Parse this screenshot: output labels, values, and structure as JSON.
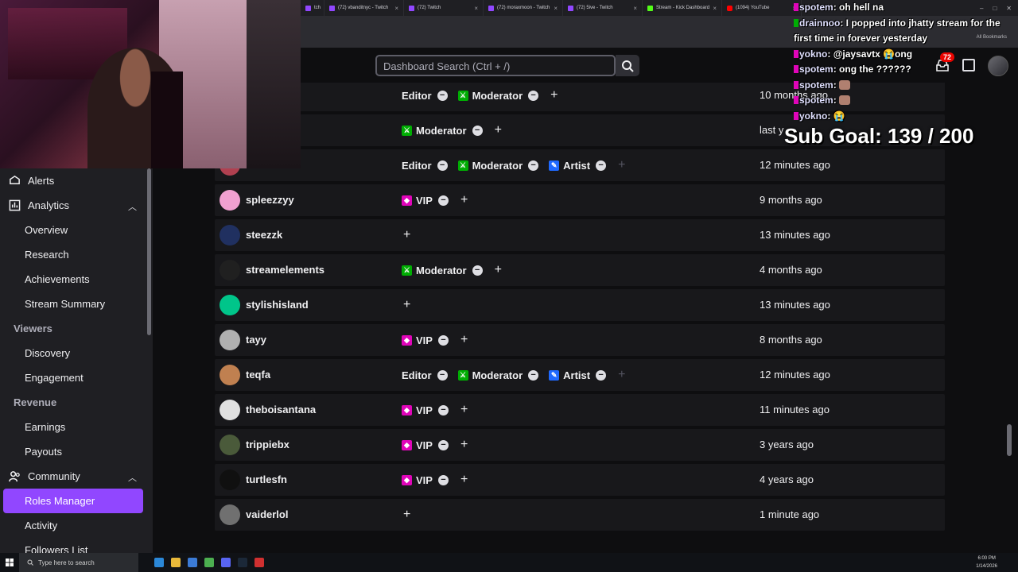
{
  "browser": {
    "tabs": [
      {
        "label": "tch",
        "icon": "twitch-icon"
      },
      {
        "label": "(72) vbanditnyc - Twitch",
        "icon": "twitch-icon"
      },
      {
        "label": "(72) Twitch",
        "icon": "twitch-icon"
      },
      {
        "label": "(72) moraxmoon - Twitch",
        "icon": "twitch-icon"
      },
      {
        "label": "(72) 5ive - Twitch",
        "icon": "twitch-icon"
      },
      {
        "label": "Stream - Kick Dashboard",
        "icon": "kick-icon"
      },
      {
        "label": "(1094) YouTube",
        "icon": "youtube-icon"
      }
    ],
    "all_bookmarks": "All Bookmarks"
  },
  "topbar": {
    "search_placeholder": "Dashboard Search (Ctrl + /)",
    "notification_count": "72"
  },
  "sidebar": {
    "items": [
      {
        "label": "Alerts",
        "type": "top",
        "icon": "alert-icon"
      },
      {
        "label": "Analytics",
        "type": "top",
        "icon": "analytics-icon",
        "expanded": true
      },
      {
        "label": "Overview",
        "type": "sub"
      },
      {
        "label": "Research",
        "type": "sub"
      },
      {
        "label": "Achievements",
        "type": "sub"
      },
      {
        "label": "Stream Summary",
        "type": "sub"
      },
      {
        "label": "Viewers",
        "type": "heading"
      },
      {
        "label": "Discovery",
        "type": "sub"
      },
      {
        "label": "Engagement",
        "type": "sub"
      },
      {
        "label": "Revenue",
        "type": "heading"
      },
      {
        "label": "Earnings",
        "type": "sub"
      },
      {
        "label": "Payouts",
        "type": "sub"
      },
      {
        "label": "Community",
        "type": "top",
        "icon": "community-icon",
        "expanded": true
      },
      {
        "label": "Roles Manager",
        "type": "sub",
        "active": true
      },
      {
        "label": "Activity",
        "type": "sub"
      },
      {
        "label": "Followers List",
        "type": "sub"
      }
    ]
  },
  "roles_table": {
    "rows": [
      {
        "username": "",
        "roles": [
          "Editor",
          "Moderator"
        ],
        "plus_dim": false,
        "when": "10 months ago"
      },
      {
        "username": "",
        "roles": [
          "Moderator"
        ],
        "plus_dim": false,
        "when": "last y"
      },
      {
        "username": "somelite",
        "roles": [
          "Editor",
          "Moderator",
          "Artist"
        ],
        "plus_dim": true,
        "when": "12 minutes ago"
      },
      {
        "username": "spleezzyy",
        "roles": [
          "VIP"
        ],
        "plus_dim": false,
        "when": "9 months ago"
      },
      {
        "username": "steezzk",
        "roles": [],
        "plus_dim": false,
        "when": "13 minutes ago"
      },
      {
        "username": "streamelements",
        "roles": [
          "Moderator"
        ],
        "plus_dim": false,
        "when": "4 months ago"
      },
      {
        "username": "stylishisland",
        "roles": [],
        "plus_dim": false,
        "when": "13 minutes ago"
      },
      {
        "username": "tayy",
        "roles": [
          "VIP"
        ],
        "plus_dim": false,
        "when": "8 months ago"
      },
      {
        "username": "teqfa",
        "roles": [
          "Editor",
          "Moderator",
          "Artist"
        ],
        "plus_dim": true,
        "when": "12 minutes ago"
      },
      {
        "username": "theboisantana",
        "roles": [
          "VIP"
        ],
        "plus_dim": false,
        "when": "11 minutes ago"
      },
      {
        "username": "trippiebx",
        "roles": [
          "VIP"
        ],
        "plus_dim": false,
        "when": "3 years ago"
      },
      {
        "username": "turtlesfn",
        "roles": [
          "VIP"
        ],
        "plus_dim": false,
        "when": "4 years ago"
      },
      {
        "username": "vaiderlol",
        "roles": [],
        "plus_dim": false,
        "when": "1 minute ago"
      }
    ]
  },
  "chat": {
    "messages": [
      {
        "user": "spotem",
        "text": "oh hell na"
      },
      {
        "user": "drainnoo",
        "text": "I popped into jhatty stream for the first time in forever yesterday"
      },
      {
        "user": "yokno",
        "text": "@jaysavtx 😭ong"
      },
      {
        "user": "spotem",
        "text": "ong the ??????"
      },
      {
        "user": "spotem",
        "text": ""
      },
      {
        "user": "spotem",
        "text": ""
      },
      {
        "user": "yokno",
        "text": "😭"
      }
    ],
    "sub_goal": "Sub Goal:  139 / 200"
  },
  "taskbar": {
    "search_placeholder": "Type here to search",
    "time": "6:00 PM",
    "date": "1/14/2026"
  },
  "colors": {
    "accent": "#9147ff",
    "moderator": "#00ad03",
    "vip": "#e005b9",
    "artist": "#1f69ff"
  }
}
